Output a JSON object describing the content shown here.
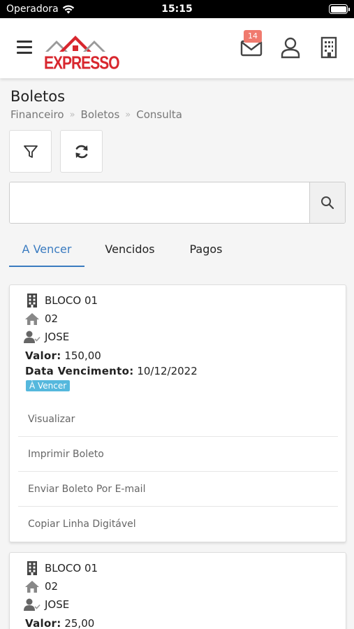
{
  "status_bar": {
    "carrier": "Operadora",
    "time": "15:15"
  },
  "header": {
    "logo_text": "EXPRESSO",
    "messages_badge": "14",
    "colors": {
      "brand_red": "#d8272e",
      "badge": "#f07a6e"
    }
  },
  "page": {
    "title": "Boletos",
    "breadcrumb": [
      "Financeiro",
      "Boletos",
      "Consulta"
    ]
  },
  "search": {
    "value": "",
    "placeholder": ""
  },
  "tabs": [
    {
      "label": "A Vencer",
      "active": true
    },
    {
      "label": "Vencidos",
      "active": false
    },
    {
      "label": "Pagos",
      "active": false
    }
  ],
  "boletos": [
    {
      "bloco": "BLOCO 01",
      "unidade": "02",
      "morador": "JOSE",
      "valor_label": "Valor:",
      "valor": "150,00",
      "vencimento_label": "Data Vencimento:",
      "vencimento": "10/12/2022",
      "status": "À Vencer",
      "actions": [
        "Visualizar",
        "Imprimir Boleto",
        "Enviar Boleto Por E-mail",
        "Copiar Linha Digitável"
      ]
    },
    {
      "bloco": "BLOCO 01",
      "unidade": "02",
      "morador": "JOSE",
      "valor_label": "Valor:",
      "valor": "25,00"
    }
  ],
  "colors": {
    "accent_blue": "#3a7bc0",
    "status_blue": "#55b8dd"
  }
}
